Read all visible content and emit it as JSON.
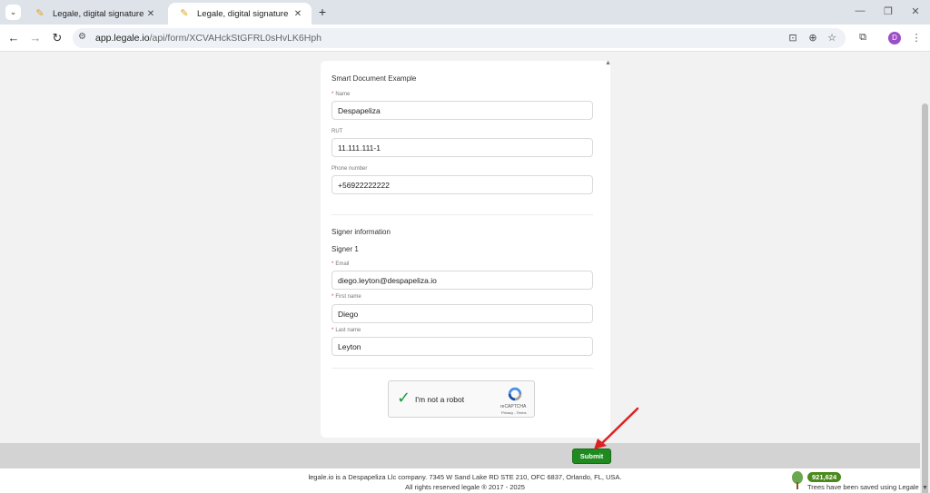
{
  "browser": {
    "tabs": [
      {
        "title": "Legale, digital signature",
        "active": false
      },
      {
        "title": "Legale, digital signature",
        "active": true
      }
    ],
    "url_host": "app.legale.io",
    "url_path": "/api/form/XCVAHckStGFRL0sHvLK6Hph",
    "profile_initial": "D"
  },
  "form": {
    "document_title": "Smart Document Example",
    "fields": {
      "name": {
        "label": "Name",
        "required": true,
        "value": "Despapeliza"
      },
      "rut": {
        "label": "RUT",
        "required": false,
        "value": "11.111.111-1"
      },
      "phone": {
        "label": "Phone number",
        "required": false,
        "value": "+56922222222"
      }
    },
    "signer_section_title": "Signer information",
    "signer_title": "Signer 1",
    "signer": {
      "email": {
        "label": "Email",
        "required": true,
        "value": "diego.leyton@despapeliza.io"
      },
      "first_name": {
        "label": "First name",
        "required": true,
        "value": "Diego"
      },
      "last_name": {
        "label": "Last name",
        "required": true,
        "value": "Leyton"
      }
    },
    "captcha": {
      "label": "I'm not a robot",
      "brand": "reCAPTCHA",
      "links": "Privacy - Terms"
    },
    "submit_label": "Submit"
  },
  "footer": {
    "line1": "legale.io is a Despapeliza Llc company. 7345 W Sand Lake RD STE 210, OFC 6837, Orlando, FL, USA.",
    "line2": "All rights reserved legale ® 2017 - 2025",
    "tree_count": "921,624",
    "tree_text": "Trees have been saved using Legale"
  },
  "colors": {
    "submit": "#1f8a1f",
    "required_marker": "#e53935",
    "annotation_arrow": "#e02020",
    "tree_badge": "#4a8a1c"
  },
  "icons": [
    "tab-list-icon",
    "pen-favicon-icon",
    "close-icon",
    "plus-icon",
    "minimize-icon",
    "restore-icon",
    "back-arrow-icon",
    "forward-arrow-icon",
    "reload-icon",
    "site-info-icon",
    "install-app-icon",
    "zoom-icon",
    "star-icon",
    "extensions-icon",
    "kebab-menu-icon",
    "check-icon",
    "recaptcha-logo-icon",
    "tree-icon"
  ]
}
